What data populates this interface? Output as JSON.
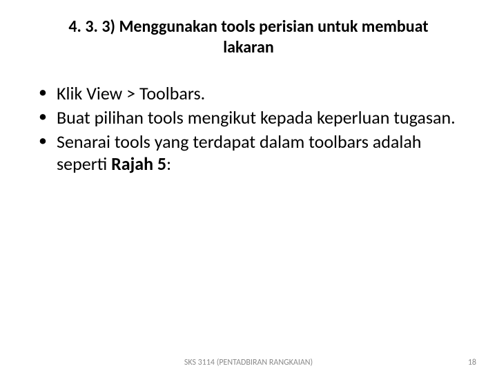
{
  "title_line1": "4. 3. 3) Menggunakan tools perisian untuk membuat",
  "title_line2": "lakaran",
  "bullets": [
    {
      "text": "Klik View > Toolbars."
    },
    {
      "text": "Buat pilihan tools mengikut kepada keperluan tugasan."
    },
    {
      "text_pre": "Senarai tools yang terdapat dalam toolbars adalah seperti ",
      "bold": "Rajah 5",
      "text_post": ":"
    }
  ],
  "footer_center": "SKS 3114 (PENTADBIRAN RANGKAIAN)",
  "footer_page": "18"
}
